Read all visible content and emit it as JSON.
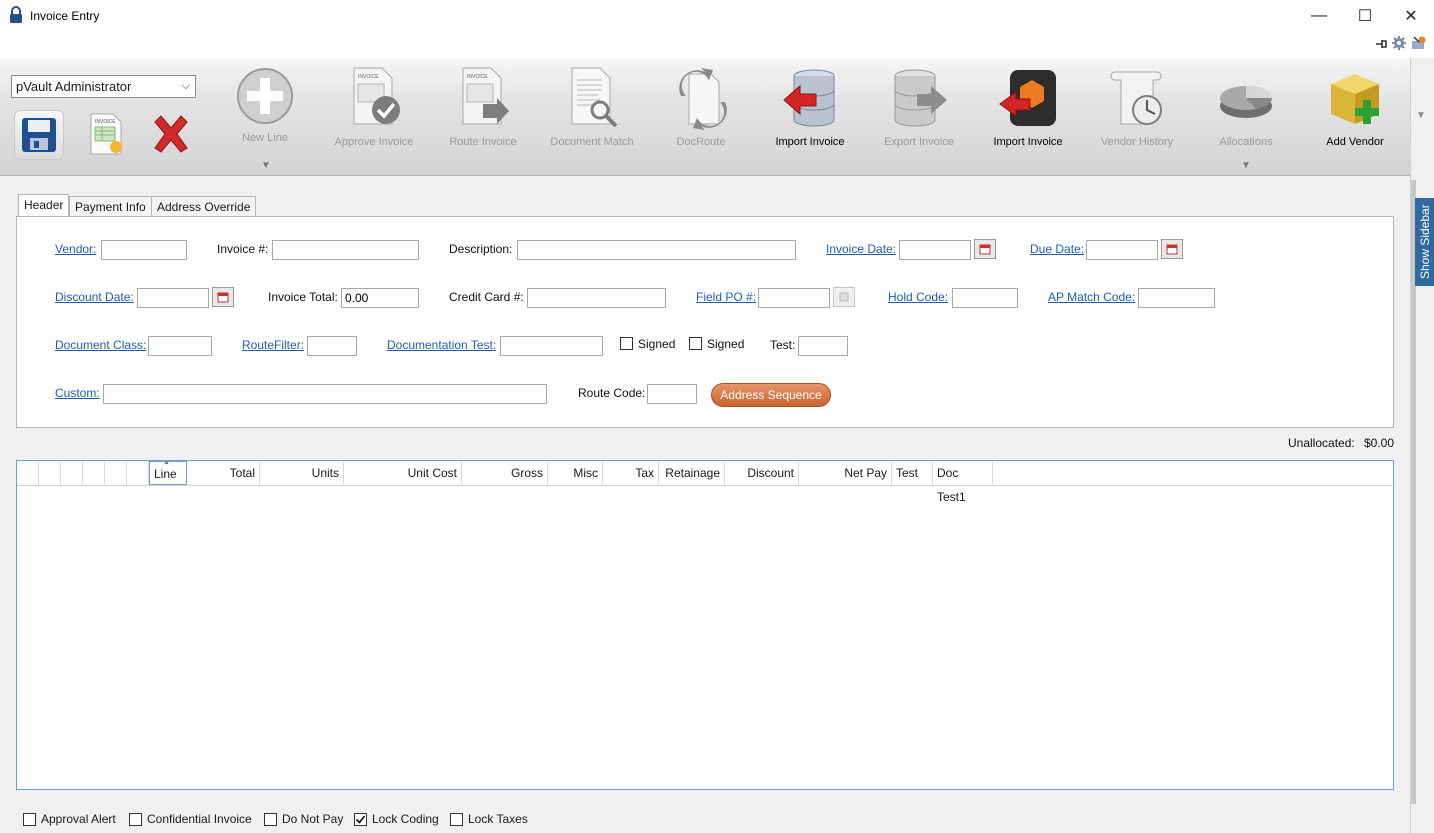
{
  "window": {
    "title": "Invoice Entry",
    "controls": {
      "minimize": "—",
      "maximize": "☐",
      "close": "✕"
    }
  },
  "user": {
    "selected": "pVault Administrator"
  },
  "toolbar": {
    "buttons": [
      {
        "label": "New Line",
        "enabled": false,
        "icon": "plus-circle-icon"
      },
      {
        "label": "Approve Invoice",
        "enabled": false,
        "icon": "approve-invoice-icon"
      },
      {
        "label": "Route Invoice",
        "enabled": false,
        "icon": "route-invoice-icon"
      },
      {
        "label": "Document Match",
        "enabled": false,
        "icon": "document-match-icon"
      },
      {
        "label": "DocRoute",
        "enabled": false,
        "icon": "docroute-icon"
      },
      {
        "label": "Import Invoice",
        "enabled": true,
        "icon": "database-import-icon"
      },
      {
        "label": "Export Invoice",
        "enabled": false,
        "icon": "database-export-icon"
      },
      {
        "label": "Import Invoice",
        "enabled": true,
        "icon": "import-invoice-alt-icon"
      },
      {
        "label": "Vendor History",
        "enabled": false,
        "icon": "vendor-history-icon"
      },
      {
        "label": "Allocations",
        "enabled": false,
        "icon": "allocations-pie-icon"
      },
      {
        "label": "Add Vendor",
        "enabled": true,
        "icon": "add-vendor-icon"
      }
    ]
  },
  "sidebar": {
    "toggle_label": "Show Sidebar"
  },
  "tabs": [
    "Header",
    "Payment Info",
    "Address Override"
  ],
  "header_form": {
    "vendor_label": "Vendor:",
    "invoice_num_label": "Invoice #:",
    "description_label": "Description:",
    "invoice_date_label": "Invoice Date:",
    "due_date_label": "Due Date:",
    "discount_date_label": "Discount Date:",
    "invoice_total_label": "Invoice Total:",
    "invoice_total_value": "0.00",
    "credit_card_label": "Credit Card #:",
    "field_po_label": "Field PO #:",
    "hold_code_label": "Hold Code:",
    "ap_match_code_label": "AP Match Code:",
    "document_class_label": "Document Class:",
    "route_filter_label": "RouteFilter:",
    "documentation_test_label": "Documentation Test:",
    "signed1_label": "Signed",
    "signed2_label": "Signed",
    "test_label": "Test:",
    "custom_label": "Custom:",
    "route_code_label": "Route Code:",
    "address_sequence_button": "Address Sequence"
  },
  "unallocated": {
    "label": "Unallocated:",
    "value": "$0.00"
  },
  "grid": {
    "columns": [
      "Line",
      "Total",
      "Units",
      "Unit Cost",
      "Gross",
      "Misc",
      "Tax",
      "Retainage",
      "Discount",
      "Net Pay",
      "Test",
      "Doc Test1"
    ],
    "rows": []
  },
  "bottom_options": [
    {
      "label": "Approval Alert",
      "checked": false
    },
    {
      "label": "Confidential Invoice",
      "checked": false
    },
    {
      "label": "Do Not Pay",
      "checked": false
    },
    {
      "label": "Lock Coding",
      "checked": true
    },
    {
      "label": "Lock Taxes",
      "checked": false
    }
  ],
  "colors": {
    "link": "#1f5fb0",
    "accent_button": "#d8763f",
    "sidebar_tab": "#2e6aa0"
  }
}
